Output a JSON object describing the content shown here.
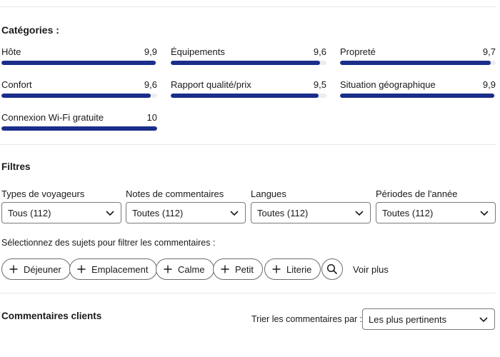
{
  "categories": {
    "title": "Catégories :",
    "items": [
      {
        "label": "Hôte",
        "score": "9,9",
        "fraction": 0.99
      },
      {
        "label": "Équipements",
        "score": "9,6",
        "fraction": 0.96
      },
      {
        "label": "Propreté",
        "score": "9,7",
        "fraction": 0.97
      },
      {
        "label": "Confort",
        "score": "9,6",
        "fraction": 0.96
      },
      {
        "label": "Rapport qualité/prix",
        "score": "9,5",
        "fraction": 0.95
      },
      {
        "label": "Situation géographique",
        "score": "9,9",
        "fraction": 0.99
      },
      {
        "label": "Connexion Wi-Fi gratuite",
        "score": "10",
        "fraction": 1.0
      }
    ],
    "bar_color": "#1a2e8a"
  },
  "filters": {
    "title": "Filtres",
    "dropdowns": [
      {
        "label": "Types de voyageurs",
        "value": "Tous (112)"
      },
      {
        "label": "Notes de commentaires",
        "value": "Toutes (112)"
      },
      {
        "label": "Langues",
        "value": "Toutes (112)"
      },
      {
        "label": "Périodes de l'année",
        "value": "Toutes (112)"
      }
    ],
    "topics_prompt": "Sélectionnez des sujets pour filtrer les commentaires :",
    "topics": [
      "Déjeuner",
      "Emplacement",
      "Calme",
      "Petit",
      "Literie"
    ],
    "see_more": "Voir plus"
  },
  "reviews": {
    "title": "Commentaires clients",
    "sort_label": "Trier les commentaires par :",
    "sort_value": "Les plus pertinents"
  }
}
